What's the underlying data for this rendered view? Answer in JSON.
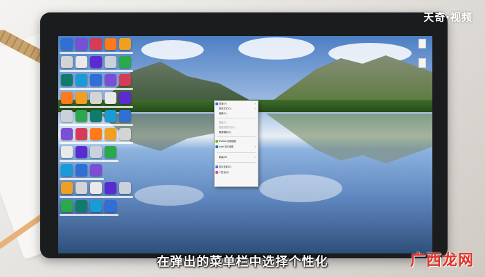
{
  "watermark": "天奇·视频",
  "caption": "在弹出的菜单栏中选择个性化",
  "logo": "广西龙网",
  "desktop": {
    "context_menu": {
      "items": [
        {
          "label": "查看(V)",
          "arrow": true
        },
        {
          "label": "排序方式(O)",
          "arrow": true
        },
        {
          "label": "刷新(E)",
          "arrow": false
        },
        {
          "label": "粘贴(P)",
          "disabled": true
        },
        {
          "label": "粘贴快捷方式(S)",
          "disabled": true
        },
        {
          "label": "撤消删除(U)",
          "arrow": false
        },
        {
          "label": "NVIDIA 控制面板",
          "arrow": false
        },
        {
          "label": "Intel 显卡设置",
          "arrow": false
        },
        {
          "label": "新建(W)",
          "arrow": true
        },
        {
          "label": "显示设置(D)",
          "arrow": false
        },
        {
          "label": "个性化(R)",
          "arrow": false
        }
      ]
    }
  },
  "colors": {
    "monitor_bezel": "#1b1c1e",
    "menu_bg": "#f6f6f6",
    "caption_text": "#ffffff",
    "logo_red": "#e0332b"
  }
}
